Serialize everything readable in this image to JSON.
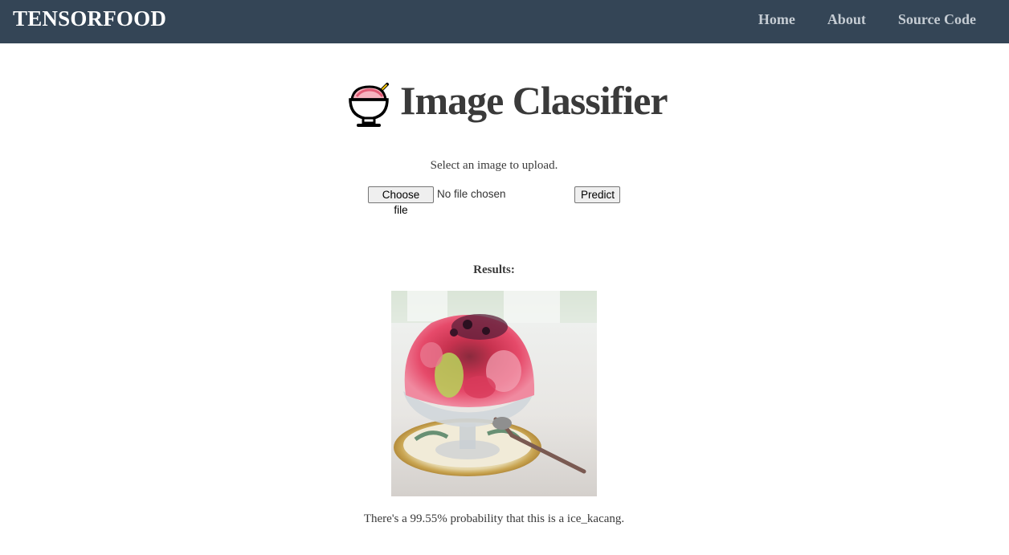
{
  "navbar": {
    "brand": "TENSORFOOD",
    "links": [
      "Home",
      "About",
      "Source Code"
    ]
  },
  "header": {
    "icon": "shaved-ice-icon",
    "title": "Image Classifier"
  },
  "upload": {
    "instruction": "Select an image to upload.",
    "choose_label": "Choose file",
    "file_status": "No file chosen",
    "predict_label": "Predict"
  },
  "results": {
    "label": "Results:",
    "image_subject": "ice-kacang-photo",
    "prediction_text": "There's a 99.55% probability that this is a ice_kacang."
  },
  "colors": {
    "navbar_bg": "#344556",
    "brand_text": "#ffffff",
    "nav_link": "#c5ccd3",
    "body_text": "#3a3a3a"
  }
}
